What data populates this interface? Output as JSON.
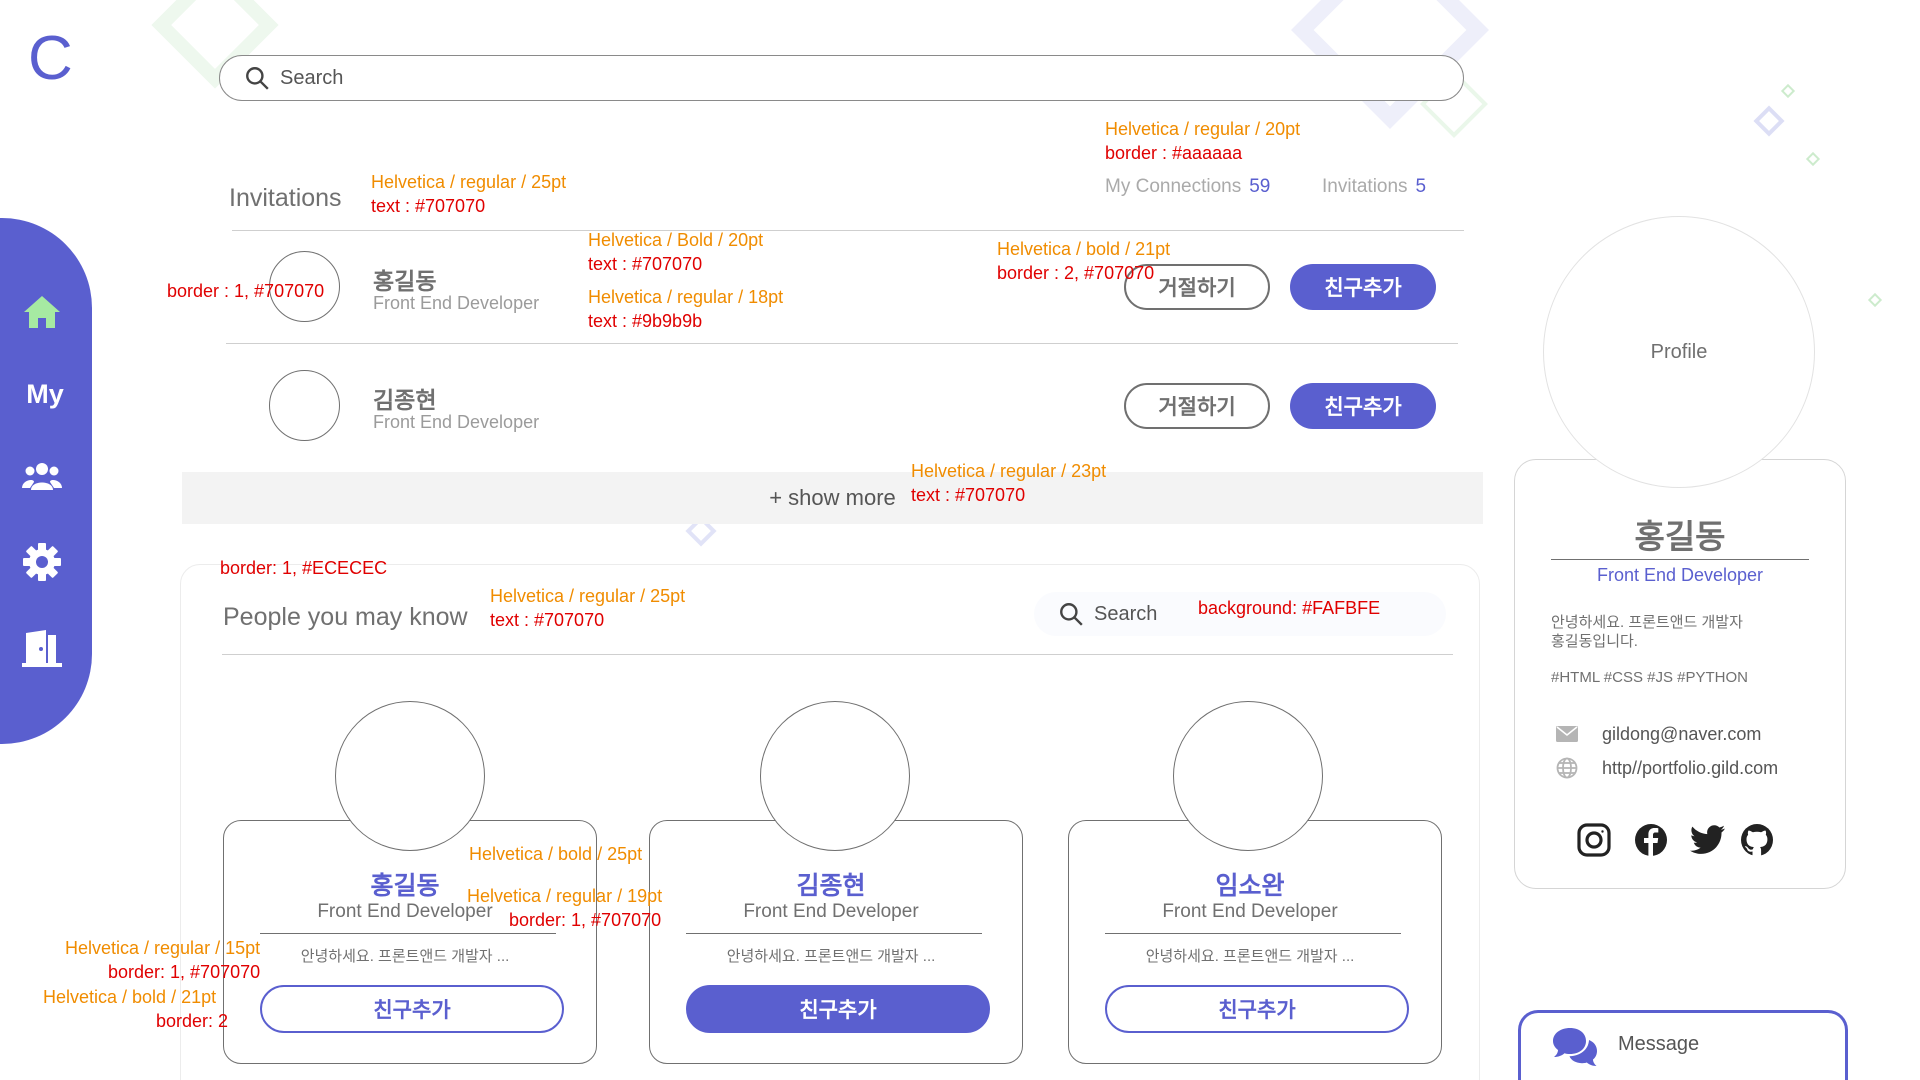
{
  "colors": {
    "accent": "#5a5fcf",
    "text": "#707070",
    "muted": "#9b9b9b",
    "border_light": "#ECECEC",
    "search_bg": "#FAFBFE",
    "annotation_orange": "#f08c00",
    "annotation_red": "#e00000"
  },
  "logo": "C",
  "search": {
    "placeholder": "Search"
  },
  "sidebar": {
    "items": [
      {
        "icon": "home-icon"
      },
      {
        "label": "My"
      },
      {
        "icon": "people-icon"
      },
      {
        "icon": "gear-icon"
      },
      {
        "icon": "logout-icon"
      }
    ]
  },
  "invitations": {
    "title": "Invitations",
    "my_connections_label": "My Connections",
    "my_connections_count": "59",
    "invitations_label": "Invitations",
    "invitations_count": "5",
    "rows": [
      {
        "name": "홍길동",
        "role": "Front End Developer",
        "reject": "거절하기",
        "accept": "친구추가"
      },
      {
        "name": "김종현",
        "role": "Front End Developer",
        "reject": "거절하기",
        "accept": "친구추가"
      }
    ],
    "show_more": "+ show more"
  },
  "people": {
    "title": "People you may know",
    "search_placeholder": "Search",
    "cards": [
      {
        "name": "홍길동",
        "role": "Front End Developer",
        "desc": "안녕하세요. 프론트앤드 개발자 ...",
        "button": "친구추가",
        "filled": false
      },
      {
        "name": "김종현",
        "role": "Front End Developer",
        "desc": "안녕하세요. 프론트앤드 개발자 ...",
        "button": "친구추가",
        "filled": true
      },
      {
        "name": "임소완",
        "role": "Front End Developer",
        "desc": "안녕하세요. 프론트앤드 개발자 ...",
        "button": "친구추가",
        "filled": false
      }
    ]
  },
  "profile": {
    "photo_label": "Profile",
    "name": "홍길동",
    "role": "Front End Developer",
    "bio_line1": "안녕하세요. 프론트앤드 개발자",
    "bio_line2": "홍길동입니다.",
    "tags": "#HTML #CSS #JS #PYTHON",
    "email": "gildong@naver.com",
    "website": "http//portfolio.gild.com",
    "socials": [
      "instagram-icon",
      "facebook-icon",
      "twitter-icon",
      "github-icon"
    ]
  },
  "message": {
    "label": "Message"
  },
  "annotations": {
    "a1": {
      "font": "Helvetica / regular / 20pt",
      "style": "border : #aaaaaa"
    },
    "a2": {
      "font": "Helvetica / regular / 25pt",
      "style": "text : #707070"
    },
    "a3": {
      "font": "Helvetica / Bold / 20pt",
      "style": "text : #707070"
    },
    "a4": {
      "font": "Helvetica / regular / 18pt",
      "style": "text : #9b9b9b"
    },
    "a5": {
      "font": "Helvetica / bold / 21pt",
      "style": "border : 2, #707070"
    },
    "a6": {
      "style": "border : 1, #707070"
    },
    "a7": {
      "font": "Helvetica / regular / 23pt",
      "style": "text : #707070"
    },
    "a8": {
      "style": "border: 1, #ECECEC"
    },
    "a9": {
      "font": "Helvetica / regular / 25pt",
      "style": "text : #707070"
    },
    "a10": {
      "style": "background: #FAFBFE"
    },
    "a11": {
      "font": "Helvetica / bold / 25pt"
    },
    "a12": {
      "font": "Helvetica / regular / 19pt",
      "style": "border: 1, #707070"
    },
    "a13": {
      "font": "Helvetica / regular / 15pt",
      "style": "border: 1, #707070"
    },
    "a14": {
      "font": "Helvetica / bold / 21pt",
      "style": "border: 2"
    }
  }
}
